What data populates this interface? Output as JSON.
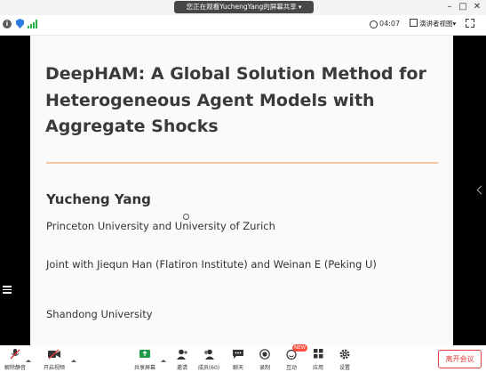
{
  "window": {
    "title": "您正在观看YuchengYang的屏幕共享",
    "title_dropdown": "▾",
    "minimize": "–",
    "maximize": "□",
    "close": "✕"
  },
  "topbar": {
    "info_icon": "info-icon",
    "timer": "04:07",
    "view_label": "演讲者视图",
    "view_dropdown": "▾"
  },
  "slide": {
    "title": "DeepHAM: A Global Solution Method for Heterogeneous Agent Models with Aggregate Shocks",
    "author": "Yucheng Yang",
    "affiliation": "Princeton University and University of Zurich",
    "joint": "Joint with Jiequn Han (Flatiron Institute) and Weinan E (Peking U)",
    "venue": "Shandong University"
  },
  "toolbar": {
    "mute_label": "解除静音",
    "video_label": "开启视频",
    "share_label": "共享屏幕",
    "invite_label": "邀请",
    "members_label": "成员(60)",
    "chat_label": "聊天",
    "record_label": "录制",
    "apps_label": "应用",
    "interact_label": "互动",
    "settings_label": "设置",
    "new_badge": "NEW",
    "leave_label": "离开会议"
  },
  "colors": {
    "accent_rule": "#f1c7a3",
    "leave_red": "#e23b3b",
    "signal_green": "#29b34a",
    "shield_blue": "#2f7be4"
  }
}
